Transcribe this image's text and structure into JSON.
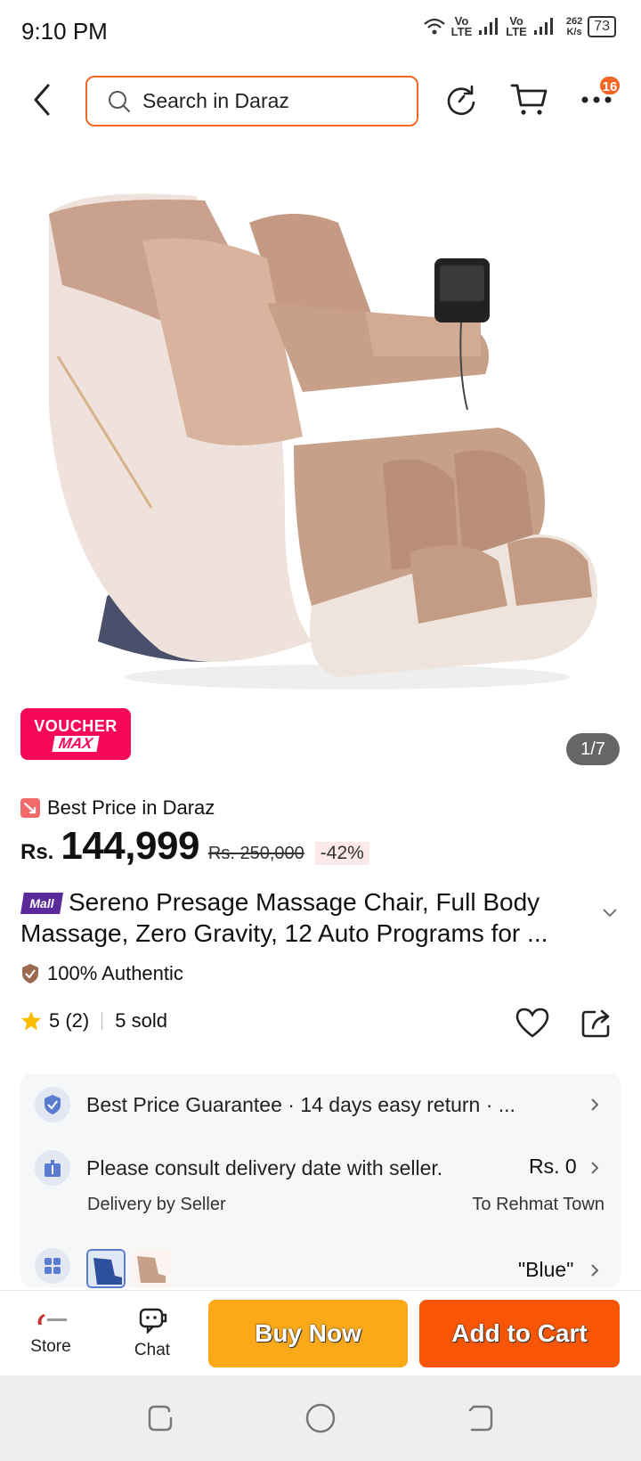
{
  "status_bar": {
    "time": "9:10 PM",
    "net_1": "Vo\nLTE",
    "net_2": "Vo\nLTE",
    "speed": "262\nK/s",
    "battery": "73"
  },
  "top_bar": {
    "search_placeholder": "Search in Daraz",
    "more_badge": "16"
  },
  "gallery": {
    "voucher_line1": "VOUCHER",
    "voucher_line2": "MAX",
    "counter": "1/7"
  },
  "pricing": {
    "best_price": "Best Price in Daraz",
    "currency": "Rs.",
    "price": "144,999",
    "original_price": "Rs. 250,000",
    "discount": "-42%"
  },
  "product": {
    "mall_tag": "Mall",
    "title": "Sereno Presage Massage Chair, Full Body Massage, Zero Gravity, 12 Auto Programs for ...",
    "authentic": "100% Authentic",
    "rating": "5 (2)",
    "sold": "5 sold"
  },
  "info": {
    "guarantee": "Best Price Guarantee  ·  14 days easy return  · ...",
    "delivery": "Please consult delivery date with seller.",
    "delivery_price": "Rs. 0",
    "delivery_by": "Delivery by Seller",
    "delivery_to": "To Rehmat Town",
    "variant_value": "\"Blue\""
  },
  "bottom_bar": {
    "store": "Store",
    "chat": "Chat",
    "buy_now": "Buy Now",
    "add_to_cart": "Add to Cart"
  },
  "colors": {
    "accent": "#f26522",
    "buy_now": "#fba919",
    "add_to_cart": "#f85606",
    "voucher": "#f8085a"
  }
}
